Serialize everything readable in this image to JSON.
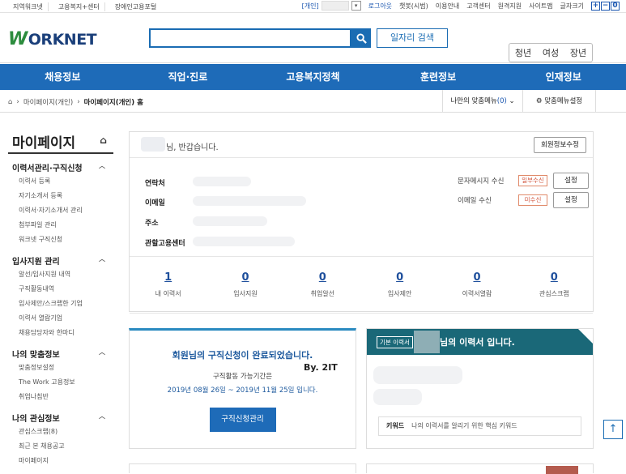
{
  "topbar": {
    "links": [
      "지역워크넷",
      "고용복지+센터",
      "장애인고용포털"
    ],
    "user_type": "[개인]",
    "dropdown_icon": "chevron-down-icon",
    "logout": "로그아웃",
    "chatbot": "챗봇(시범)",
    "guide": "이용안내",
    "support": "고객센터",
    "remote": "원격지원",
    "sitemap": "사이트맵",
    "font_size": "글자크기",
    "font_buttons": [
      "+",
      "−",
      "0"
    ]
  },
  "header": {
    "logo_w": "W",
    "logo_rest": "ORKNET",
    "search_placeholder": "",
    "search_icon": "search-icon",
    "job_search": "일자리 검색",
    "persona": [
      "청년",
      "여성",
      "장년"
    ]
  },
  "nav": [
    "채용정보",
    "직업·진로",
    "고용복지정책",
    "훈련정보",
    "인재정보"
  ],
  "breadcrumb": {
    "home_icon": "home-icon",
    "items": [
      "마이페이지(개인)",
      "마이페이지(개인) 홈"
    ],
    "my_menu": "나만의 맞춤메뉴",
    "my_menu_count": "(0)",
    "menu_settings": "맞춤메뉴설정"
  },
  "sidebar": {
    "title": "마이페이지",
    "sections": [
      {
        "title": "이력서관리·구직신청",
        "items": [
          "이력서 등록",
          "자기소개서 등록",
          "이력서·자기소개서 관리",
          "첨부파일 관리",
          "워크넷 구직신청"
        ]
      },
      {
        "title": "입사지원 관리",
        "items": [
          "알선/입사지원 내역",
          "구직활동내역",
          "입사제안/스크랩한 기업",
          "이력서 열람기업",
          "채용담당자와 한마디"
        ]
      },
      {
        "title": "나의 맞춤정보",
        "items": [
          "맞춤정보설정",
          "The Work 고용정보",
          "취업나침반"
        ]
      },
      {
        "title": "나의 관심정보",
        "items": [
          "관심스크랩(8)",
          "최근 본 채용공고",
          "마이페이지"
        ]
      }
    ]
  },
  "main": {
    "welcome": "님, 반갑습니다.",
    "edit_profile": "회원정보수정",
    "labels": [
      "연락처",
      "이메일",
      "주소",
      "관할고용센터"
    ],
    "sms_label": "문자메시지 수신",
    "sms_status": "일부수신",
    "email_label": "이메일 수신",
    "email_status": "미수신",
    "setting": "설정",
    "stats": [
      {
        "num": "1",
        "label": "내 이력서"
      },
      {
        "num": "0",
        "label": "입사지원"
      },
      {
        "num": "0",
        "label": "취업알선"
      },
      {
        "num": "0",
        "label": "입사제안"
      },
      {
        "num": "0",
        "label": "이력서열람"
      },
      {
        "num": "0",
        "label": "관심스크랩"
      }
    ]
  },
  "card_apply": {
    "title": "회원님의 구직신청이 완료되었습니다.",
    "period_label": "구직활동 가능기간은",
    "period": "2019년 08월 26일 ~ 2019년 11월 25일 입니다.",
    "button": "구직신청관리"
  },
  "watermark": "By. 2IT",
  "card_resume": {
    "tag": "기본 이력서",
    "title": "님의 이력서 입니다.",
    "keyword_label": "키워드",
    "keyword_text": "나의 이력서를 알리기 위한 핵심 키워드"
  },
  "scroll_top": "↑",
  "colors": {
    "primary": "#1e6bb8",
    "logo_green": "#2c8c3e",
    "teal": "#1a6878",
    "status_red": "#d2543c"
  }
}
